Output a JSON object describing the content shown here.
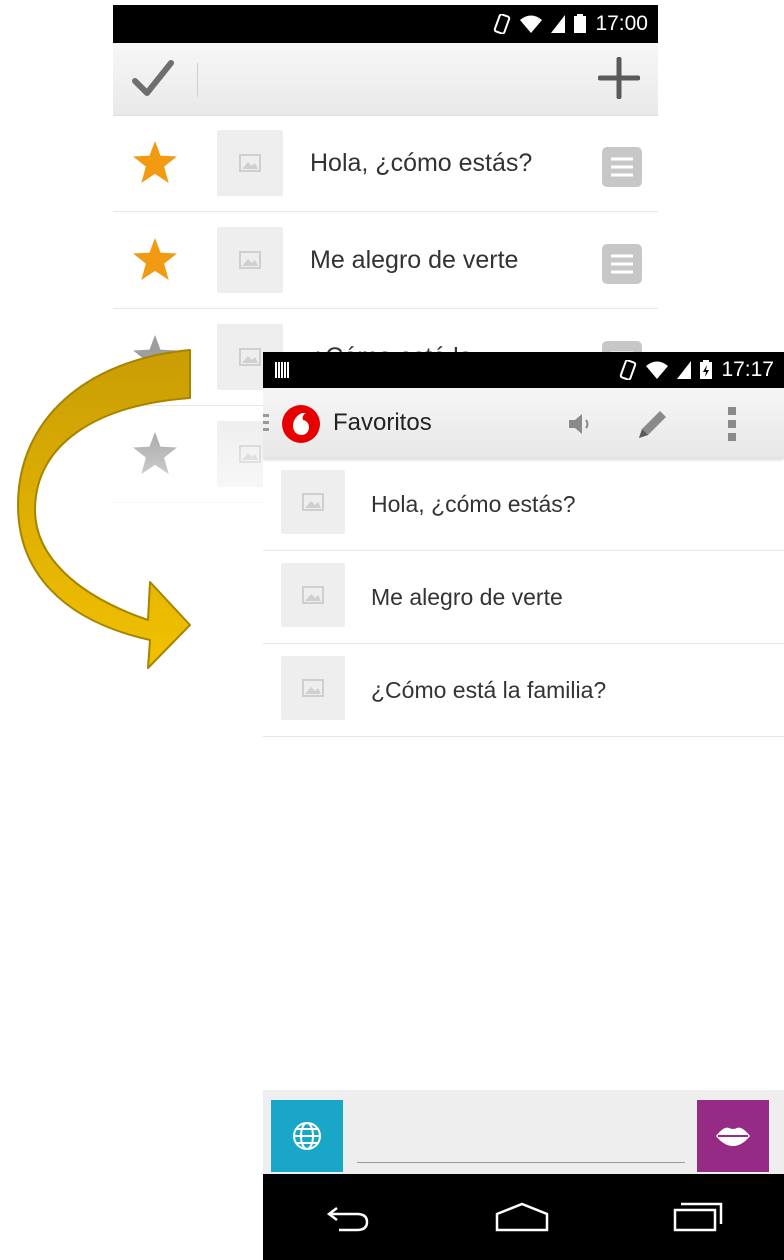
{
  "back_screen": {
    "status_time": "17:00",
    "phrases": [
      {
        "text": "Hola, ¿cómo estás?",
        "favorite": true
      },
      {
        "text": "Me alegro de verte",
        "favorite": true
      },
      {
        "text": "¿Cómo está la",
        "favorite": false
      },
      {
        "text": "",
        "favorite": false
      }
    ],
    "colors": {
      "star_on": "#f29a12",
      "star_off": "#9e9e9e"
    }
  },
  "front_screen": {
    "status_time": "17:17",
    "title": "Favoritos",
    "phrases": [
      "Hola, ¿cómo estás?",
      "Me alegro de verte",
      "¿Cómo está la familia?"
    ],
    "input": {
      "value": "",
      "placeholder": ""
    },
    "colors": {
      "globe_button": "#1aa6c8",
      "lips_button": "#962b86",
      "arrow": "#f2b705",
      "logo": "#e60000"
    }
  }
}
